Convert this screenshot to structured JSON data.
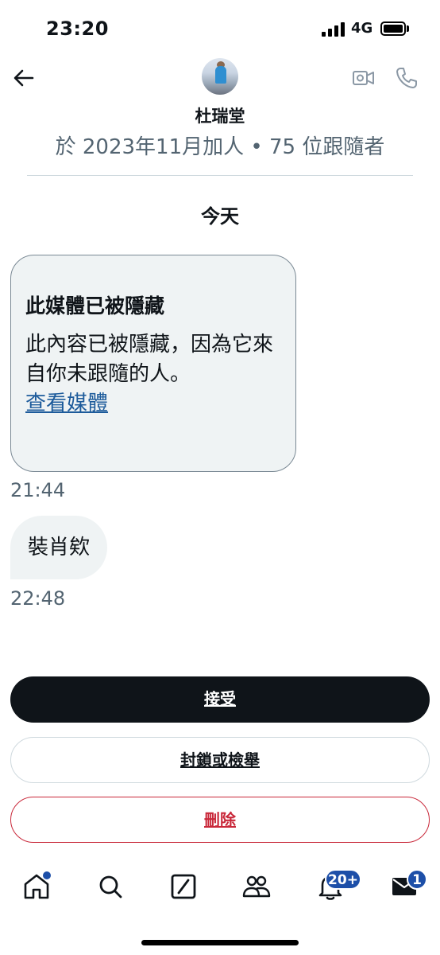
{
  "status_bar": {
    "time": "23:20",
    "network": "4G"
  },
  "header": {
    "contact_name": "杜瑞堂",
    "contact_meta": "於 2023年11月加人 • 75 位跟隨者"
  },
  "conversation": {
    "day_label": "今天",
    "hidden_media": {
      "title": "此媒體已被隱藏",
      "description": "此內容已被隱藏，因為它來自你未跟隨的人。",
      "link": "查看媒體",
      "timestamp": "21:44"
    },
    "message": {
      "text": "裝肖欸",
      "timestamp": "22:48"
    }
  },
  "actions": {
    "accept_label": "接受",
    "block_report_label": "封鎖或檢舉",
    "delete_label": "刪除"
  },
  "bottom_nav": {
    "items": [
      {
        "name": "home-icon",
        "has_dot": true
      },
      {
        "name": "search-icon"
      },
      {
        "name": "grok-icon"
      },
      {
        "name": "communities-icon"
      },
      {
        "name": "notifications-icon",
        "badge": "20+"
      },
      {
        "name": "messages-icon",
        "badge": "1"
      }
    ]
  },
  "colors": {
    "accent": "#1d4fa8",
    "danger": "#c9283a",
    "muted": "#536471",
    "bubble": "#eff3f4"
  }
}
